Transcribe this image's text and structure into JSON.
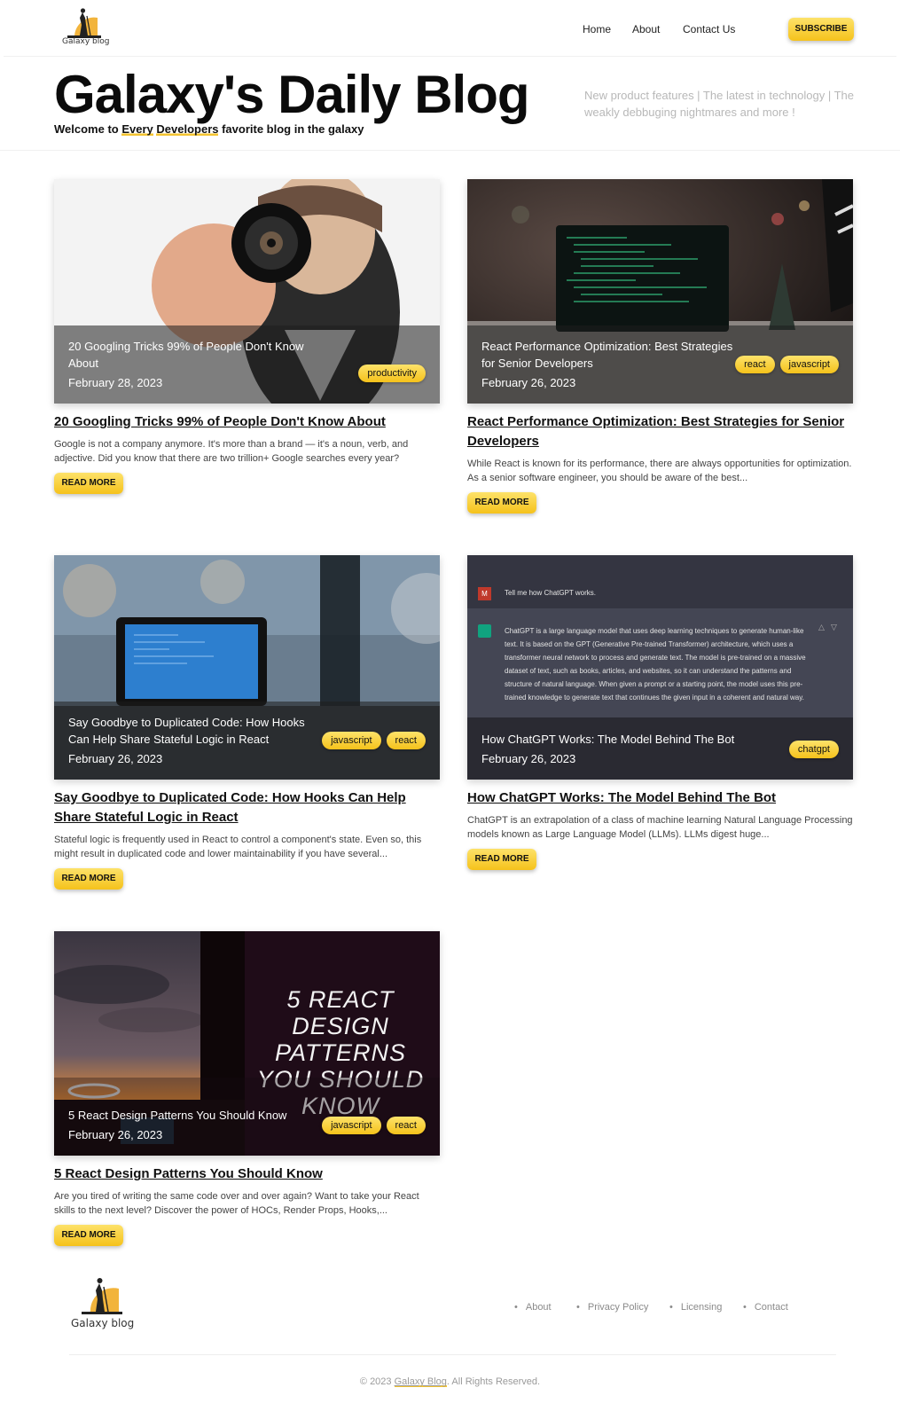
{
  "brand": {
    "logo_text": "Galaxy blog",
    "accent": "#f5c21b"
  },
  "nav": {
    "home": "Home",
    "about": "About",
    "contact": "Contact Us",
    "subscribe": "SUBSCRIBE"
  },
  "hero": {
    "title": "Galaxy's Daily Blog",
    "sub_prefix": "Welcome to ",
    "sub_hl_1": "Every",
    "sub_space": " ",
    "sub_hl_2": "Developers",
    "sub_suffix": " favorite blog in the galaxy",
    "tagline": "New product features | The latest in technology | The weakly debbuging nightmares and more !"
  },
  "posts": [
    {
      "overlay_title": "20 Googling Tricks 99% of People Don't Know About",
      "date": "February 28, 2023",
      "tags": [
        "productivity"
      ],
      "title": "20 Googling Tricks 99% of People Don't Know About",
      "excerpt": "Google is not a company anymore. It's more than a brand — it's a noun, verb, and adjective. Did you know that there are two trillion+ Google searches every year?",
      "read_more": "READ MORE"
    },
    {
      "overlay_title": "React Performance Optimization: Best Strategies for Senior Developers",
      "date": "February 26, 2023",
      "tags": [
        "react",
        "javascript"
      ],
      "title": "React Performance Optimization: Best Strategies for Senior Developers",
      "excerpt": "While React is known for its performance, there are always opportunities for optimization. As a senior software engineer, you should be aware of the best...",
      "read_more": "READ MORE"
    },
    {
      "overlay_title": "Say Goodbye to Duplicated Code: How Hooks Can Help Share Stateful Logic in React",
      "date": "February 26, 2023",
      "tags": [
        "javascript",
        "react"
      ],
      "title": "Say Goodbye to Duplicated Code: How Hooks Can Help Share Stateful Logic in React",
      "excerpt": "Stateful logic is frequently used in React to control a component's state. Even so, this might result in duplicated code and lower maintainability if you have several...",
      "read_more": "READ MORE"
    },
    {
      "overlay_title": "How ChatGPT Works: The Model Behind The Bot",
      "date": "February 26, 2023",
      "tags": [
        "chatgpt"
      ],
      "title": "How ChatGPT Works: The Model Behind The Bot",
      "excerpt": "ChatGPT is an extrapolation of a class of machine learning Natural Language Processing models known as Large Language Model (LLMs). LLMs digest huge...",
      "read_more": "READ MORE",
      "image_prompt": "Tell me how ChatGPT works.",
      "image_prompt_avatar": "M",
      "image_answer": "ChatGPT is a large language model that uses deep learning techniques to generate human-like text. It is based on the GPT (Generative Pre-trained Transformer) architecture, which uses a transformer neural network to process and generate text. The model is pre-trained on a massive dataset of text, such as books, articles, and websites, so it can understand the patterns and structure of natural language. When given a prompt or a starting point, the model uses this pre-trained knowledge to generate text that continues the given input in a coherent and natural way."
    },
    {
      "overlay_title": "5 React Design Patterns You Should Know",
      "date": "February 26, 2023",
      "tags": [
        "javascript",
        "react"
      ],
      "title": "5 React Design Patterns You Should Know",
      "excerpt": "Are you tired of writing the same code over and over again? Want to take your React skills to the next level? Discover the power of HOCs, Render Props, Hooks,...",
      "read_more": "READ MORE",
      "image_text": "5 REACT DESIGN PATTERNS YOU SHOULD KNOW"
    }
  ],
  "footer": {
    "logo_text": "Galaxy blog",
    "links": [
      "About",
      "Privacy Policy",
      "Licensing",
      "Contact"
    ],
    "copyright_prefix": "© 2023 ",
    "copyright_brand": "Galaxy Blog",
    "copyright_suffix": ". All Rights Reserved."
  }
}
